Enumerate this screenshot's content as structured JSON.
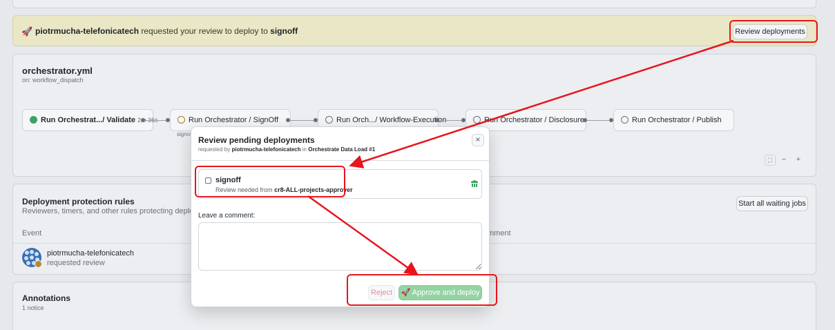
{
  "banner": {
    "user": "piotrmucha-telefonicatech",
    "text": "requested your review to deploy to",
    "env": "signoff",
    "button": "Review deployments"
  },
  "workflow": {
    "title": "orchestrator.yml",
    "trigger": "on: workflow_dispatch",
    "jobs": [
      {
        "label": "Run Orchestrat.../ Validate",
        "duration": "2m 36s",
        "status": "success"
      },
      {
        "label": "Run Orchestrator / SignOff",
        "sub": "signoff",
        "status": "waiting"
      },
      {
        "label": "Run Orch.../ Workflow-Execution",
        "status": "pending"
      },
      {
        "label": "Run Orchestrator / Disclosure",
        "status": "pending"
      },
      {
        "label": "Run Orchestrator / Publish",
        "status": "pending"
      }
    ],
    "zoom": {
      "minus": "−",
      "plus": "+"
    }
  },
  "protection": {
    "title": "Deployment protection rules",
    "subtitle": "Reviewers, timers, and other rules protecting deployments",
    "start_button": "Start all waiting jobs",
    "col_event": "Event",
    "col_comment": "mment",
    "row_user": "piotrmucha-telefonicatech",
    "row_action": "requested review"
  },
  "annotations": {
    "title": "Annotations",
    "count": "1 notice"
  },
  "modal": {
    "title": "Review pending deployments",
    "sub_prefix": "requested by",
    "sub_user": "piotrmucha-telefonicatech",
    "sub_in": "in",
    "sub_run": "Orchestrate Data Load #1",
    "close": "×",
    "env_name": "signoff",
    "env_req_prefix": "Review needed from",
    "env_req_team": "cr8-ALL-projects-approver",
    "comment_label": "Leave a comment:",
    "reject": "Reject",
    "approve": "Approve and deploy"
  },
  "colors": {
    "highlight": "#e8141b",
    "success": "#3fa164",
    "approve_bg": "#94d3a2"
  }
}
